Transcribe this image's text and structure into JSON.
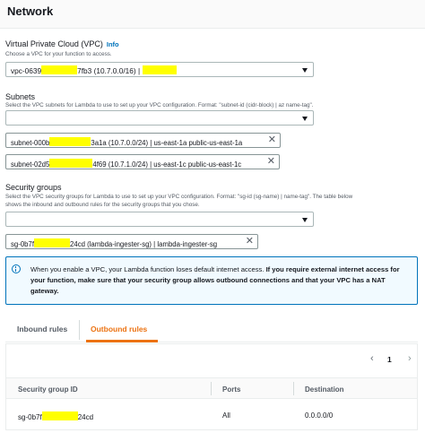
{
  "section_title": "Network",
  "vpc": {
    "label": "Virtual Private Cloud (VPC)",
    "info": "Info",
    "description": "Choose a VPC for your function to access.",
    "value_prefix": "vpc-0639",
    "value_suffix": "7fb3 (10.7.0.0/16) |"
  },
  "subnets": {
    "label": "Subnets",
    "description": "Select the VPC subnets for Lambda to use to set up your VPC configuration. Format: \"subnet-id (cidr-block) | az name-tag\".",
    "selected": [
      {
        "prefix": "subnet-000b",
        "suffix": "3a1a (10.7.0.0/24) | us-east-1a public-us-east-1a"
      },
      {
        "prefix": "subnet-02d5",
        "suffix": "4f69 (10.7.1.0/24) | us-east-1c public-us-east-1c"
      }
    ]
  },
  "security_groups": {
    "label": "Security groups",
    "description_line1": "Select the VPC security groups for Lambda to use to set up your VPC configuration. Format: \"sg-id (sg-name) | name-tag\". The table below",
    "description_line2": "shows the inbound and outbound rules for the security groups that you chose.",
    "selected": [
      {
        "prefix": "sg-0b7f",
        "suffix": "24cd (lambda-ingester-sg) | lambda-ingester-sg"
      }
    ]
  },
  "alert": {
    "normal": "When you enable a VPC, your Lambda function loses default internet access. ",
    "bold": "If you require external internet access for your function, make sure that your security group allows outbound connections and that your VPC has a NAT gateway."
  },
  "tabs": [
    {
      "label": "Inbound rules",
      "active": false
    },
    {
      "label": "Outbound rules",
      "active": true
    }
  ],
  "table": {
    "page": "1",
    "columns": [
      "Security group ID",
      "Ports",
      "Destination"
    ],
    "rows": [
      {
        "sg_prefix": "sg-0b7f",
        "sg_suffix": "24cd",
        "ports": "All",
        "destination": "0.0.0.0/0"
      }
    ]
  },
  "colors": {
    "accent_orange": "#ec7211",
    "link_blue": "#0073bb",
    "redaction_yellow": "#ffff00"
  },
  "icons": [
    "close-icon",
    "info-icon",
    "chevron-down-icon",
    "chevron-left-icon",
    "chevron-right-icon"
  ]
}
